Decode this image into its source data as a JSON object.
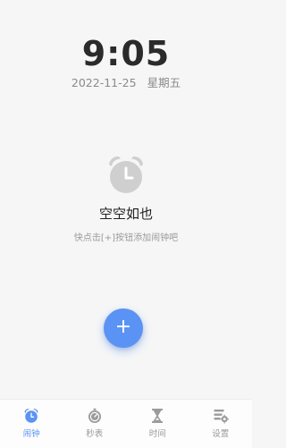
{
  "clock": {
    "time": "9:05",
    "date": "2022-11-25",
    "weekday": "星期五"
  },
  "empty_state": {
    "icon": "alarm-clock-icon",
    "title": "空空如也",
    "hint": "快点击[+]按钮添加闹钟吧"
  },
  "fab": {
    "label": "+",
    "color": "#5b93f4"
  },
  "tabbar": {
    "active_color": "#5b93f4",
    "inactive_color": "#9b9b9b",
    "items": [
      {
        "label": "闹钟",
        "icon": "alarm-clock-icon",
        "active": true
      },
      {
        "label": "秒表",
        "icon": "stopwatch-icon",
        "active": false
      },
      {
        "label": "时间",
        "icon": "hourglass-icon",
        "active": false
      },
      {
        "label": "设置",
        "icon": "settings-icon",
        "active": false
      }
    ]
  }
}
